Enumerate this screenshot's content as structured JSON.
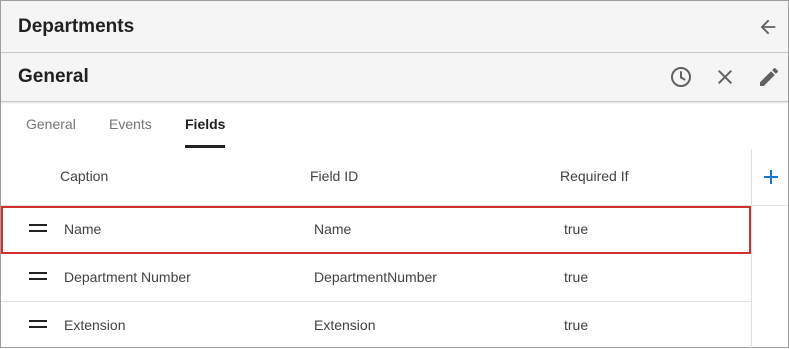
{
  "header": {
    "title": "Departments",
    "back_icon": "arrow-left-icon"
  },
  "subheader": {
    "title": "General",
    "icons": [
      "history-icon",
      "close-icon",
      "edit-pencil-icon"
    ]
  },
  "tabs": [
    {
      "label": "General",
      "active": false
    },
    {
      "label": "Events",
      "active": false
    },
    {
      "label": "Fields",
      "active": true
    }
  ],
  "table": {
    "columns": [
      "Caption",
      "Field ID",
      "Required If"
    ],
    "add_icon": "plus-icon",
    "accent_color": "#1976d2",
    "selection_color": "#d32f2f",
    "rows": [
      {
        "caption": "Name",
        "field_id": "Name",
        "required_if": "true",
        "selected": true
      },
      {
        "caption": "Department Number",
        "field_id": "DepartmentNumber",
        "required_if": "true",
        "selected": false
      },
      {
        "caption": "Extension",
        "field_id": "Extension",
        "required_if": "true",
        "selected": false
      }
    ]
  }
}
